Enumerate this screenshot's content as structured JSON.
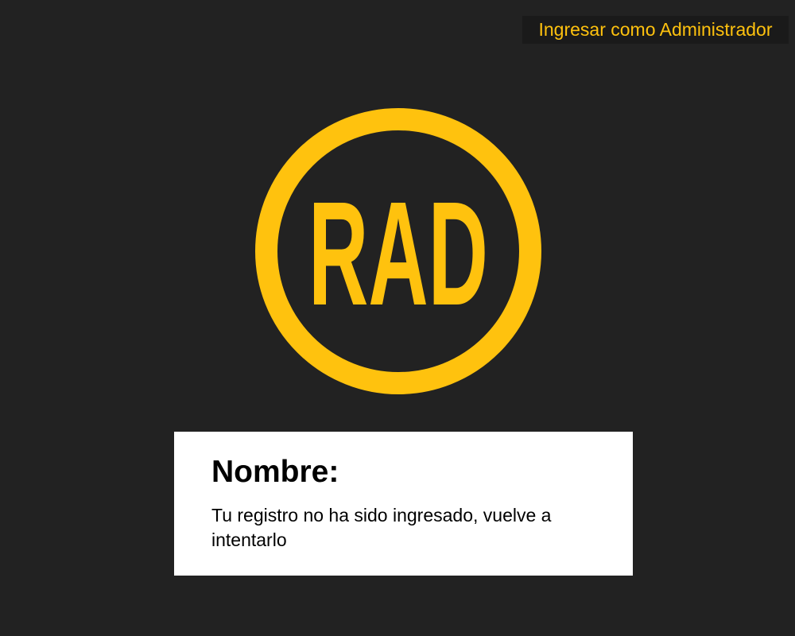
{
  "header": {
    "admin_link_label": "Ingresar como Administrador"
  },
  "logo": {
    "text": "RAD",
    "color": "#FFC20E",
    "background": "#222222"
  },
  "card": {
    "title": "Nombre:",
    "message": "Tu registro no ha sido ingresado, vuelve a intentarlo"
  },
  "colors": {
    "page_background": "#222222",
    "accent": "#FFC20E",
    "card_background": "#ffffff"
  }
}
